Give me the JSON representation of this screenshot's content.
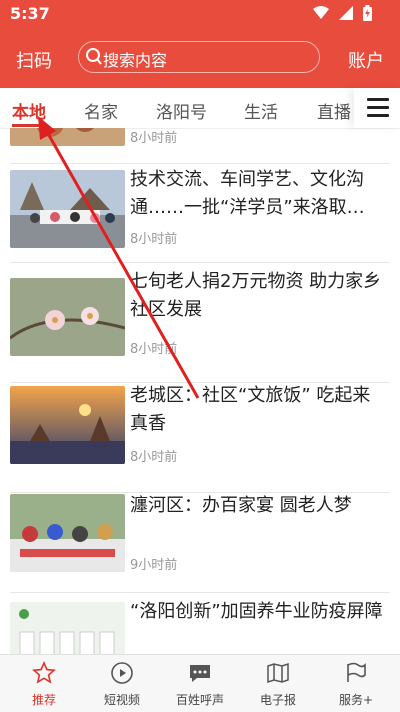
{
  "status": {
    "time": "5:37"
  },
  "header": {
    "scan": "扫码",
    "search_placeholder": "搜索内容",
    "account": "账户"
  },
  "tabs": [
    "本地",
    "名家",
    "洛阳号",
    "生活",
    "直播"
  ],
  "articles": [
    {
      "time": "8小时前"
    },
    {
      "title": "技术交流、车间学艺、文化沟通……一批“洋学员”来洛取…",
      "time": "8小时前"
    },
    {
      "title": "七旬老人捐2万元物资 助力家乡社区发展",
      "time": "8小时前"
    },
    {
      "title": "老城区：社区“文旅饭” 吃起来真香",
      "time": "8小时前"
    },
    {
      "title": "瀍河区：办百家宴 圆老人梦",
      "time": "9小时前"
    },
    {
      "title": "“洛阳创新”加固养牛业防疫屏障"
    }
  ],
  "bottom_nav": [
    "推荐",
    "短视频",
    "百姓呼声",
    "电子报",
    "服务+"
  ],
  "colors": {
    "brand": "#e84c3d",
    "active": "#d9362b",
    "annotation_arrow": "#e02020"
  }
}
